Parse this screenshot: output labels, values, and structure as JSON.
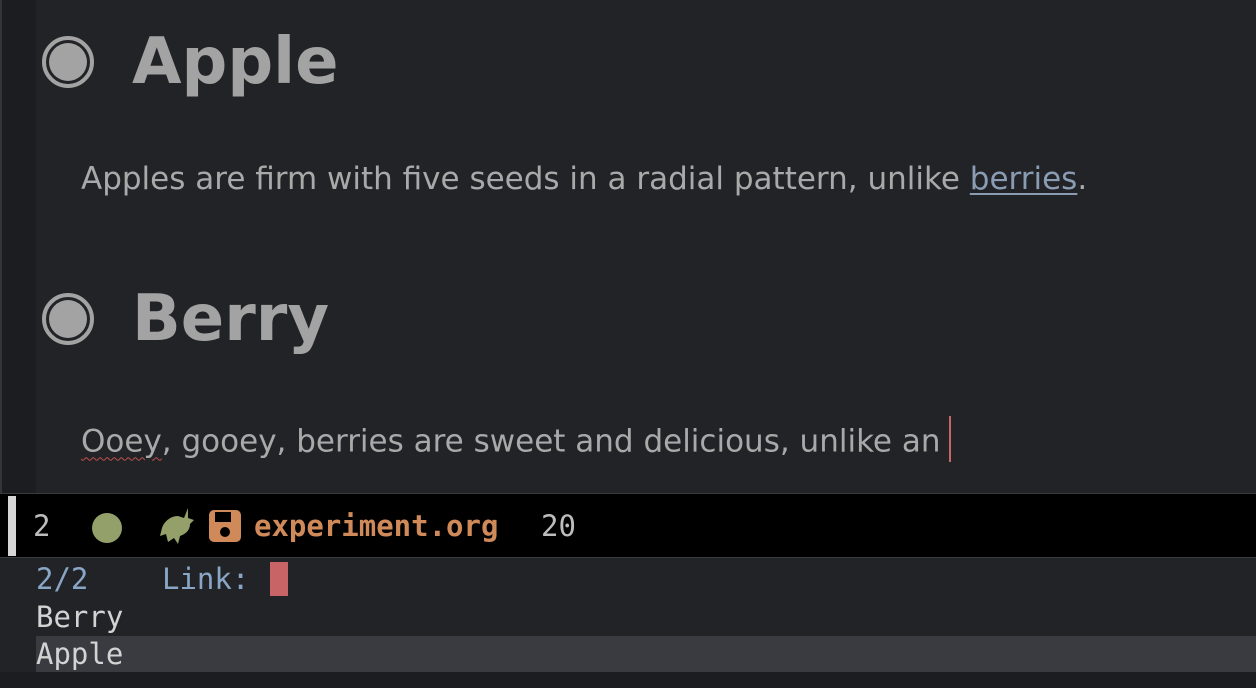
{
  "document": {
    "sections": [
      {
        "heading": "Apple",
        "body_before_link": "Apples are firm with five seeds in a radial pattern, unlike ",
        "link_text": "berries",
        "body_after_link": "."
      },
      {
        "heading": "Berry",
        "misspelled_word": "Ooey",
        "body_rest": ", gooey, berries are sweet and delicious, unlike an"
      }
    ]
  },
  "modeline": {
    "window_number": "2",
    "buffer_name": "experiment.org",
    "position": "20",
    "status_dot_color": "#94a06a",
    "mode_icon": "unicorn-icon",
    "save_icon": "floppy-disk-icon"
  },
  "minibuffer": {
    "count": "2/2",
    "prompt": "Link:",
    "candidates": [
      "Berry",
      "Apple"
    ],
    "selected_candidate": "Apple"
  }
}
